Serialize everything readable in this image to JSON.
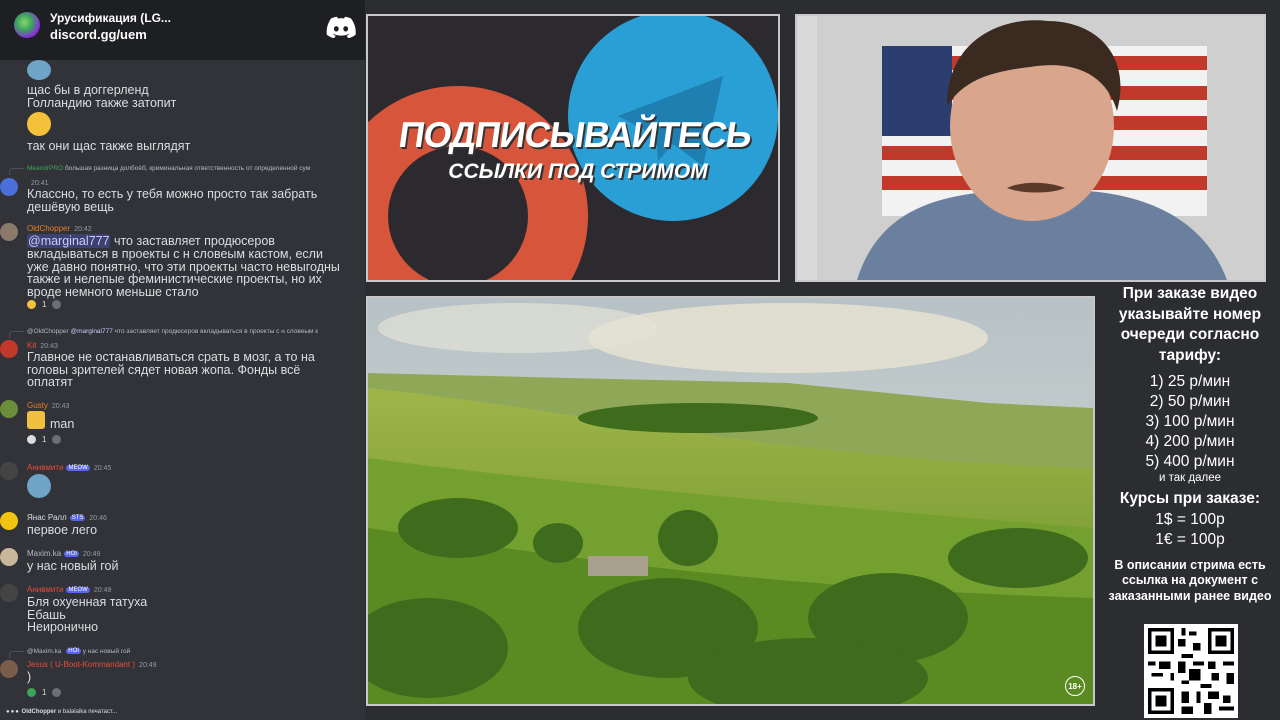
{
  "chat": {
    "server_name": "Урусификация (LG...",
    "server_invite": "discord.gg/uem",
    "messages": [
      {
        "text": "щас бы в доггерленд\nГолландию также затопит"
      },
      {
        "text": "так они щас также выглядят"
      },
      {
        "reply": "большая разница долбоёб, криминальная ответственность от определенной сум",
        "time": "20:41",
        "text": "Классно, то есть у тебя можно просто так забрать\nдешёвую вещь"
      },
      {
        "user": "OldChopper",
        "time": "20:42",
        "mention": "@marginal777",
        "text_after_mention": " что заставляет продюсеров",
        "text": "вкладываться в проекты с н словеым кастом, если\nуже давно понятно, что эти проекты часто невыгодны\nтакже и нелепые феминистические проекты, но их\nвроде немного меньше стало",
        "reaction_count": "1"
      },
      {
        "reply_user": "@OldChopper",
        "reply_mention": "@marginal777",
        "reply": " что заставляет продюсеров вкладываться в проекты с н словеым к",
        "user": "Kit",
        "time": "20:43",
        "text": "Главное не останавливаться срать в мозг, а то на\nголовы зрителей сядет новая жопа. Фонды всё\nоплатят"
      },
      {
        "user": "Gusty",
        "time": "20:43",
        "text": "man",
        "reaction_count": "1"
      },
      {
        "user": "Анивмити",
        "tag": "MEOW",
        "time": "20:45"
      },
      {
        "user": "Янас Ралл",
        "tag": "STS",
        "time": "20:46",
        "text": "первое лего"
      },
      {
        "user": "Maxim.ka",
        "tag": "HOI",
        "time": "20:49",
        "text": "у нас новый гой"
      },
      {
        "user": "Анивмити",
        "tag": "MEOW",
        "time": "20:49",
        "text": "Бля охуенная татуха\nЕбашь\nНеиронично"
      },
      {
        "reply_user": "@Maxim.ka",
        "reply_tag": "HOI",
        "reply": "у нас новый гой",
        "user": "Jesus ( U-Boot-Kommandant )",
        "time": "20:49",
        "text": ")",
        "reaction_count": "1"
      }
    ],
    "typing_users": "OldChopper",
    "typing_rest": " и balalaika печатаст..."
  },
  "promo": {
    "title": "ПОДПИСЫВАЙТЕСЬ",
    "subtitle": "ССЫЛКИ ПОД СТРИМОМ"
  },
  "video": {
    "age_rating": "18+"
  },
  "info": {
    "heading": "При заказе видео указывайте номер очереди согласно тарифу:",
    "rates": [
      "1) 25 р/мин",
      "2) 50 р/мин",
      "3) 100 р/мин",
      "4) 200 р/мин",
      "5) 400 р/мин"
    ],
    "rates_more": "и так далее",
    "courses_heading": "Курсы при заказе:",
    "courses": [
      "1$ = 100р",
      "1€ = 100р"
    ],
    "note": "В описании стрима есть ссылка на документ с заказанными ранее видео"
  },
  "colors": {
    "chat_bg": "#313338",
    "header_bg": "#1e1f22",
    "page_bg": "#2b2d31",
    "blurple": "#5865f2",
    "telegram": "#2a9fd6",
    "patreon": "#d7553a"
  }
}
